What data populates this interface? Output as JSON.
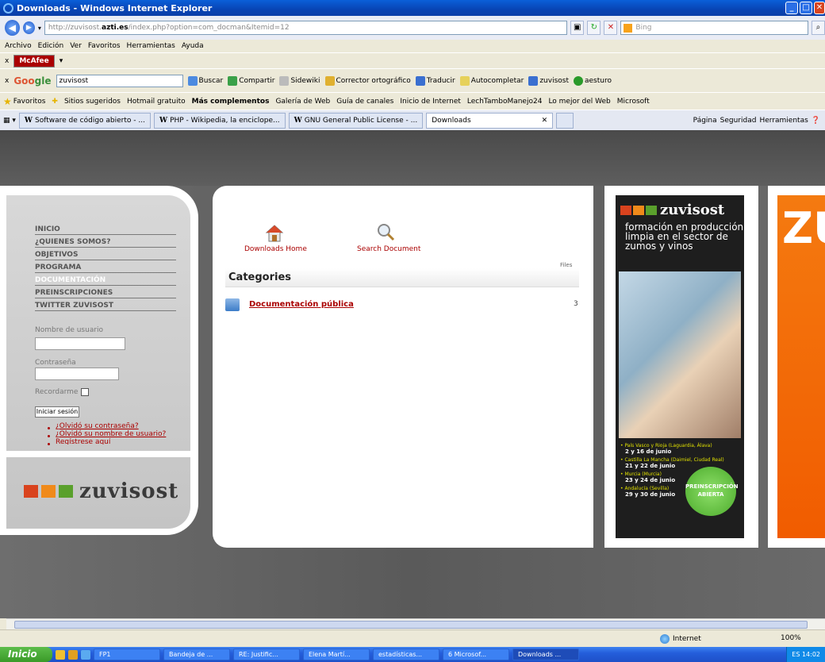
{
  "window": {
    "title": "Downloads - Windows Internet Explorer"
  },
  "address": {
    "url_prefix": "http://zuvisost.",
    "url_domain": "azti.es",
    "url_rest": "/index.php?option=com_docman&Itemid=12",
    "search_placeholder": "Bing"
  },
  "menu": [
    "Archivo",
    "Edición",
    "Ver",
    "Favoritos",
    "Herramientas",
    "Ayuda"
  ],
  "mcafee": {
    "label": "McAfee"
  },
  "google": {
    "logo_a": "Goo",
    "logo_b": "gle",
    "query": "zuvisost",
    "buttons": [
      "Buscar",
      "Compartir",
      "Sidewiki",
      "Corrector ortográfico",
      "Traducir",
      "Autocompletar",
      "zuvisost",
      "aesturo"
    ]
  },
  "favorites": {
    "label": "Favoritos",
    "items": [
      "Sitios sugeridos",
      "Hotmail gratuito",
      "Más complementos",
      "Galería de Web",
      "Guía de canales",
      "Inicio de Internet",
      "LechTamboManejo24",
      "Lo mejor del Web",
      "Microsoft"
    ]
  },
  "tabs": [
    {
      "label": "Software de código abierto - ..."
    },
    {
      "label": "PHP - Wikipedia, la enciclope..."
    },
    {
      "label": "GNU General Public License - ..."
    },
    {
      "label": "Downloads"
    }
  ],
  "toolbar_right": [
    "Página",
    "Seguridad",
    "Herramientas"
  ],
  "sidebar": {
    "items": [
      "INICIO",
      "¿QUIENES SOMOS?",
      "OBJETIVOS",
      "PROGRAMA",
      "DOCUMENTACIÓN",
      "PREINSCRIPCIONES",
      "TWITTER ZUVISOST"
    ],
    "username_label": "Nombre de usuario",
    "password_label": "Contraseña",
    "remember_label": "Recordarme",
    "login_button": "Iniciar sesión",
    "links": [
      "¿Olvidó su contraseña?",
      "¿Olvidó su nombre de usuario?",
      "Regístrese aquí"
    ],
    "logo_text": "zuvisost"
  },
  "docman": {
    "home_label": "Downloads Home",
    "search_label": "Search Document",
    "categories_title": "Categories",
    "files_label": "Files",
    "category": {
      "name": "Documentación pública",
      "count": "3"
    }
  },
  "banner": {
    "brand": "zuvisost",
    "tagline": "formación en producción limpia en el sector de zumos y vinos",
    "events": [
      {
        "place": "• País Vasco y Rioja (Laguardia, Álava)",
        "dates": "2 y 16 de junio"
      },
      {
        "place": "• Castilla La Mancha (Daimiel, Ciudad Real)",
        "dates": "21 y 22 de junio"
      },
      {
        "place": "• Murcia (Murcia)",
        "dates": "23 y 24 de junio"
      },
      {
        "place": "• Andalucía (Sevilla)",
        "dates": "29 y 30 de junio"
      }
    ],
    "badge": "PREINSCRIPCIÓN ABIERTA"
  },
  "orange_banner": {
    "letter": "ZU"
  },
  "status": {
    "zone": "Internet",
    "zoom": "100%"
  },
  "taskbar": {
    "start": "Inicio",
    "tasks": [
      "FP1",
      "Bandeja de ...",
      "RE: Justific...",
      "Elena Martí...",
      "estadísticas...",
      "6 Microsof...",
      "Downloads ..."
    ],
    "tray": "ES  14:02"
  },
  "colors": {
    "accent_red": "#aa0000",
    "ie_blue": "#0a5fd8",
    "zuvisost_red": "#d9431e",
    "zuvisost_orange": "#f08a1a",
    "zuvisost_green": "#5aa02c"
  }
}
